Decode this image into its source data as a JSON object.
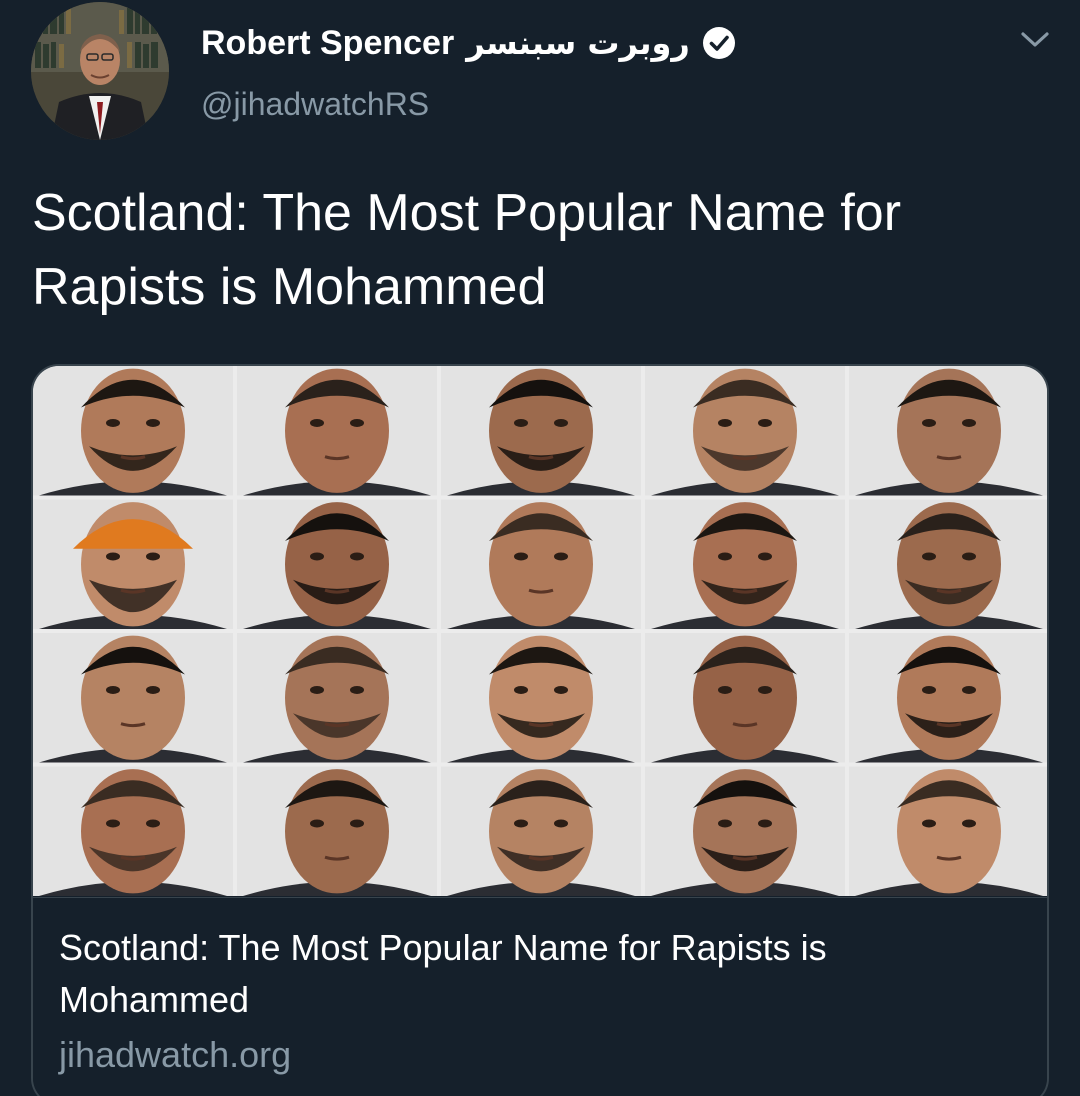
{
  "author": {
    "display_name": "Robert Spencer",
    "display_name_arabic": "روبرت سبنسر",
    "handle": "@jihadwatchRS",
    "verified": true,
    "avatar_icon": "profile-photo"
  },
  "tweet": {
    "text": "Scotland: The Most Popular Name for Rapists is Mohammed"
  },
  "card": {
    "image_description": "mugshot-grid",
    "title": "Scotland: The Most Popular Name for Rapists is Mohammed",
    "domain": "jihadwatch.org"
  },
  "icons": {
    "menu": "chevron-down-icon",
    "verified": "verified-badge-icon"
  },
  "colors": {
    "background": "#15202b",
    "text_primary": "#ffffff",
    "text_secondary": "#8899a6",
    "border": "#38444d"
  }
}
